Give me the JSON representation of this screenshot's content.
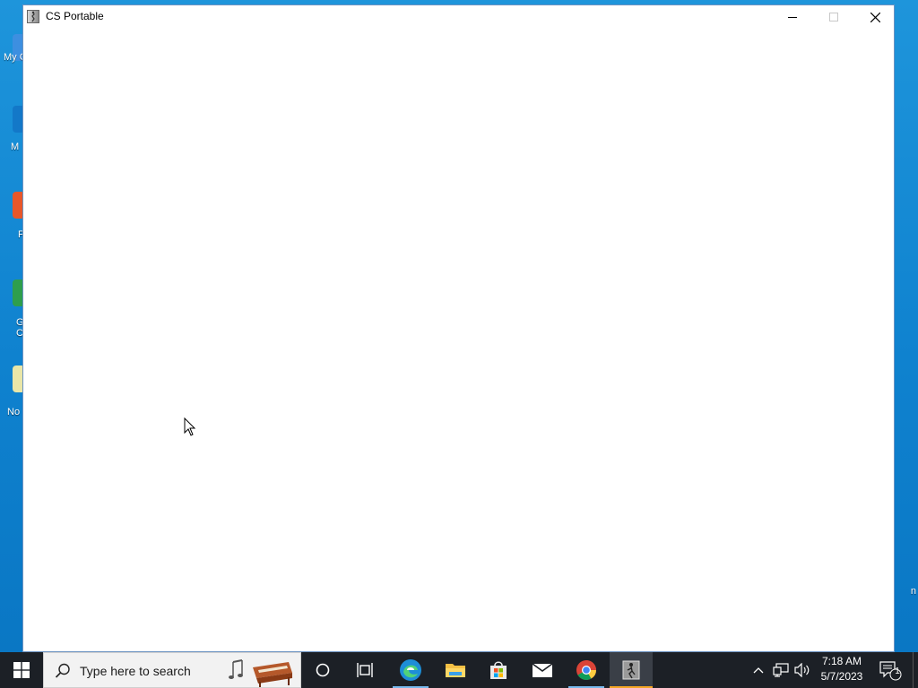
{
  "window": {
    "title": "CS Portable",
    "controls": {
      "minimize": "minimize",
      "maximize": "maximize",
      "close": "close"
    }
  },
  "desktop": {
    "icons": [
      {
        "label": "My C",
        "icon": "this-pc-icon"
      },
      {
        "label": "M",
        "icon": "edge-shortcut-icon"
      },
      {
        "label": "F",
        "icon": "firefox-shortcut-icon"
      },
      {
        "label": "G C",
        "icon": "chrome-shortcut-icon"
      },
      {
        "label": "No",
        "icon": "notepad-shortcut-icon"
      }
    ],
    "right_edge_label": "n"
  },
  "taskbar": {
    "search_placeholder": "Type here to search",
    "apps": [
      "Cortana",
      "Task View",
      "Microsoft Edge",
      "File Explorer",
      "Microsoft Store",
      "Mail",
      "Google Chrome",
      "CS Portable"
    ],
    "clock": {
      "time": "7:18 AM",
      "date": "5/7/2023"
    },
    "notification_count": "1"
  },
  "colors": {
    "desktop": "#1a8fd6",
    "taskbar": "#1c2026",
    "active_indicator": "#f5a623",
    "running_indicator": "#76b9ed"
  }
}
